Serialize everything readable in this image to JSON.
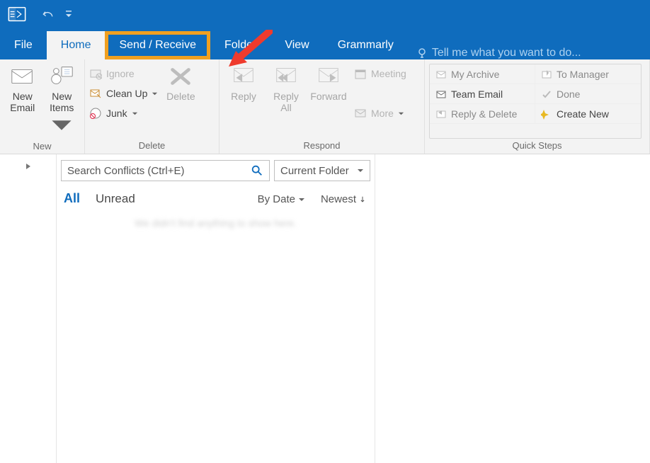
{
  "tabs": {
    "file": "File",
    "home": "Home",
    "send_receive": "Send / Receive",
    "folder": "Folder",
    "view": "View",
    "grammarly": "Grammarly"
  },
  "tellme_placeholder": "Tell me what you want to do...",
  "ribbon": {
    "new": {
      "label": "New",
      "new_email": "New\nEmail",
      "new_items": "New\nItems"
    },
    "delete": {
      "label": "Delete",
      "ignore": "Ignore",
      "cleanup": "Clean Up",
      "junk": "Junk",
      "delete_btn": "Delete"
    },
    "respond": {
      "label": "Respond",
      "reply": "Reply",
      "reply_all": "Reply\nAll",
      "forward": "Forward",
      "meeting": "Meeting",
      "more": "More"
    },
    "quicksteps": {
      "label": "Quick Steps",
      "my_archive": "My Archive",
      "to_manager": "To Manager",
      "team_email": "Team Email",
      "done": "Done",
      "reply_delete": "Reply & Delete",
      "create_new": "Create New"
    }
  },
  "search": {
    "placeholder": "Search Conflicts (Ctrl+E)",
    "scope": "Current Folder"
  },
  "filters": {
    "all": "All",
    "unread": "Unread",
    "sort_field": "By Date",
    "sort_dir": "Newest"
  },
  "empty_msg": "We didn't find anything to show here."
}
